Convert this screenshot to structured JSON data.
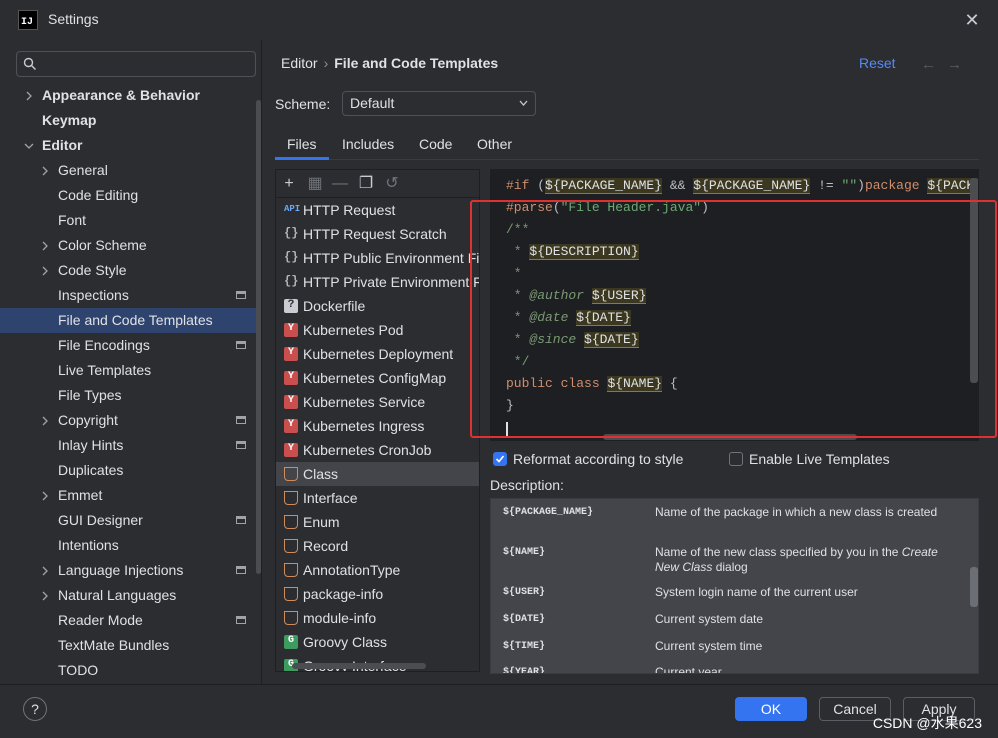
{
  "window": {
    "title": "Settings",
    "logo_text": "IJ"
  },
  "search": {
    "value": "",
    "placeholder": ""
  },
  "sidebar": {
    "items": [
      {
        "label": "Appearance & Behavior"
      },
      {
        "label": "Keymap"
      },
      {
        "label": "Editor"
      },
      {
        "label": "General"
      },
      {
        "label": "Code Editing"
      },
      {
        "label": "Font"
      },
      {
        "label": "Color Scheme"
      },
      {
        "label": "Code Style"
      },
      {
        "label": "Inspections"
      },
      {
        "label": "File and Code Templates"
      },
      {
        "label": "File Encodings"
      },
      {
        "label": "Live Templates"
      },
      {
        "label": "File Types"
      },
      {
        "label": "Copyright"
      },
      {
        "label": "Inlay Hints"
      },
      {
        "label": "Duplicates"
      },
      {
        "label": "Emmet"
      },
      {
        "label": "GUI Designer"
      },
      {
        "label": "Intentions"
      },
      {
        "label": "Language Injections"
      },
      {
        "label": "Natural Languages"
      },
      {
        "label": "Reader Mode"
      },
      {
        "label": "TextMate Bundles"
      },
      {
        "label": "TODO"
      }
    ]
  },
  "header": {
    "breadcrumb_root": "Editor",
    "breadcrumb_current": "File and Code Templates",
    "reset_label": "Reset",
    "back_arrow": "←",
    "forward_arrow": "→"
  },
  "scheme": {
    "label": "Scheme:",
    "value": "Default"
  },
  "tabs": [
    {
      "label": "Files"
    },
    {
      "label": "Includes"
    },
    {
      "label": "Code"
    },
    {
      "label": "Other"
    }
  ],
  "templates": [
    {
      "label": "HTTP Request",
      "icon": "api-icon",
      "glyph": "API"
    },
    {
      "label": "HTTP Request Scratch",
      "icon": "braces-icon",
      "glyph": "{}"
    },
    {
      "label": "HTTP Public Environment Fil",
      "icon": "braces-icon",
      "glyph": "{}"
    },
    {
      "label": "HTTP Private Environment F",
      "icon": "braces-icon",
      "glyph": "{}"
    },
    {
      "label": "Dockerfile",
      "icon": "unknown-file-icon",
      "glyph": "?"
    },
    {
      "label": "Kubernetes Pod",
      "icon": "yaml-icon",
      "glyph": "Y"
    },
    {
      "label": "Kubernetes Deployment",
      "icon": "yaml-icon",
      "glyph": "Y"
    },
    {
      "label": "Kubernetes ConfigMap",
      "icon": "yaml-icon",
      "glyph": "Y"
    },
    {
      "label": "Kubernetes Service",
      "icon": "yaml-icon",
      "glyph": "Y"
    },
    {
      "label": "Kubernetes Ingress",
      "icon": "yaml-icon",
      "glyph": "Y"
    },
    {
      "label": "Kubernetes CronJob",
      "icon": "yaml-icon",
      "glyph": "Y"
    },
    {
      "label": "Class",
      "icon": "java-class-icon",
      "glyph": ""
    },
    {
      "label": "Interface",
      "icon": "java-class-icon",
      "glyph": ""
    },
    {
      "label": "Enum",
      "icon": "java-class-icon",
      "glyph": ""
    },
    {
      "label": "Record",
      "icon": "java-class-icon",
      "glyph": ""
    },
    {
      "label": "AnnotationType",
      "icon": "java-class-icon",
      "glyph": ""
    },
    {
      "label": "package-info",
      "icon": "java-class-icon",
      "glyph": ""
    },
    {
      "label": "module-info",
      "icon": "java-class-icon",
      "glyph": ""
    },
    {
      "label": "Groovy Class",
      "icon": "groovy-icon",
      "glyph": "G"
    },
    {
      "label": "Groovy Interface",
      "icon": "groovy-icon",
      "glyph": "G"
    }
  ],
  "code": {
    "line1": {
      "kw": "#if",
      "p1": " (",
      "v1": "${PACKAGE_NAME}",
      "p2": " && ",
      "v2": "${PACKAGE_NAME}",
      "p3": " != ",
      "s1": "\"\"",
      "p4": ")",
      "kw2": "package",
      "p5": " ",
      "v3": "${PACKA"
    },
    "line2": {
      "kw": "#parse",
      "p1": "(",
      "s1": "\"File Header.java\"",
      "p2": ")"
    },
    "line3": "/**",
    "line4": {
      "p1": " * ",
      "v1": "${DESCRIPTION}"
    },
    "line5": " *",
    "line6": {
      "p1": " * ",
      "tag": "@author",
      "p2": " ",
      "v1": "${USER}"
    },
    "line7": {
      "p1": " * ",
      "tag": "@date",
      "p2": " ",
      "v1": "${DATE}"
    },
    "line8": {
      "p1": " * ",
      "tag": "@since",
      "p2": " ",
      "v1": "${DATE}"
    },
    "line9": " */",
    "line10": {
      "kw": "public class",
      "p1": " ",
      "v1": "${NAME}",
      "p2": " {"
    },
    "line11": "}"
  },
  "options": {
    "reformat_label": "Reformat according to style",
    "reformat_checked": true,
    "live_label": "Enable Live Templates",
    "live_checked": false
  },
  "description": {
    "label": "Description:",
    "rows": [
      {
        "key": "${PACKAGE_NAME}",
        "value": "Name of the package in which a new class is created"
      },
      {
        "key": "${NAME}",
        "value_pre": "Name of the new class specified by you in the ",
        "value_em": "Create New Class",
        "value_post": " dialog"
      },
      {
        "key": "${USER}",
        "value": "System login name of the current user"
      },
      {
        "key": "${DATE}",
        "value": "Current system date"
      },
      {
        "key": "${TIME}",
        "value": "Current system time"
      },
      {
        "key": "${YEAR}",
        "value": "Current year"
      }
    ]
  },
  "buttons": {
    "help": "?",
    "ok": "OK",
    "cancel": "Cancel",
    "apply": "Apply"
  },
  "watermark": "CSDN @水果623",
  "colors": {
    "accent": "#3574f0",
    "selection": "#2e436e",
    "highlight_box": "#e03131"
  }
}
